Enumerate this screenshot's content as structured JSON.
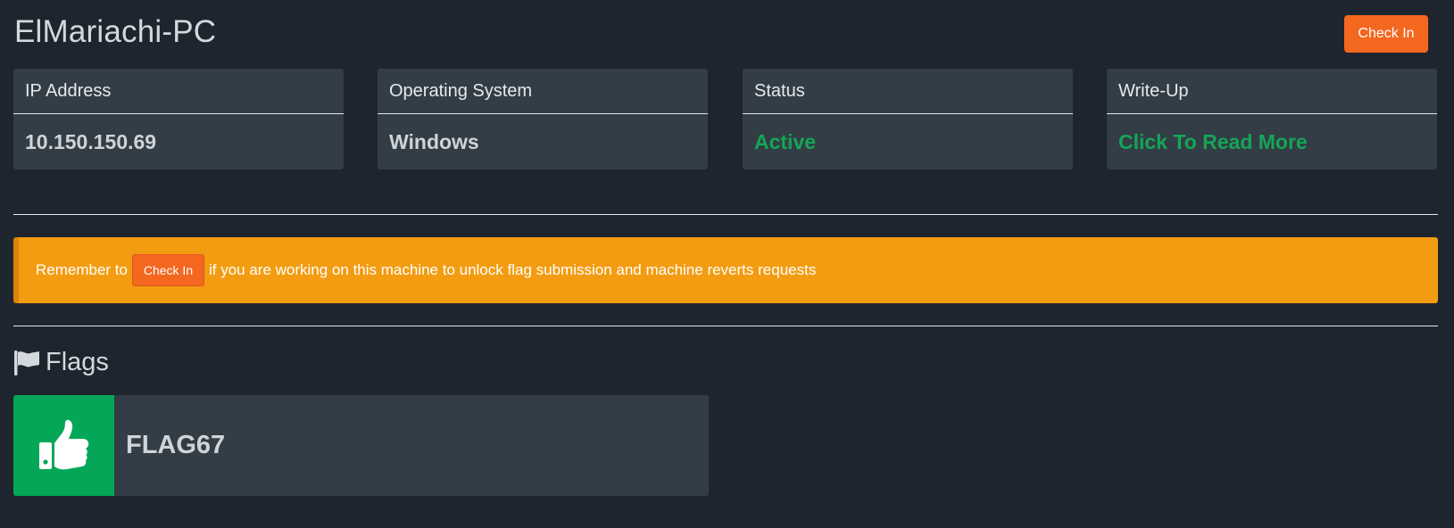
{
  "header": {
    "title": "ElMariachi-PC",
    "checkin_label": "Check In"
  },
  "cards": [
    {
      "label": "IP Address",
      "value": "10.150.150.69"
    },
    {
      "label": "Operating System",
      "value": "Windows"
    },
    {
      "label": "Status",
      "value": "Active"
    },
    {
      "label": "Write-Up",
      "value": "Click To Read More"
    }
  ],
  "alert": {
    "text_before": "Remember to",
    "button_label": "Check In",
    "text_after": "if you are working on this machine to unlock flag submission and machine reverts requests"
  },
  "flags": {
    "heading": "Flags",
    "heading_icon": "flag-icon",
    "items": [
      {
        "name": "FLAG67",
        "icon": "thumbs-up-icon",
        "status": "success"
      }
    ]
  },
  "colors": {
    "background": "#1f252e",
    "card": "#323d45",
    "accent_orange": "#f4671f",
    "alert_yellow": "#f39c12",
    "success_green": "#15a556",
    "flag_green": "#03a757"
  }
}
